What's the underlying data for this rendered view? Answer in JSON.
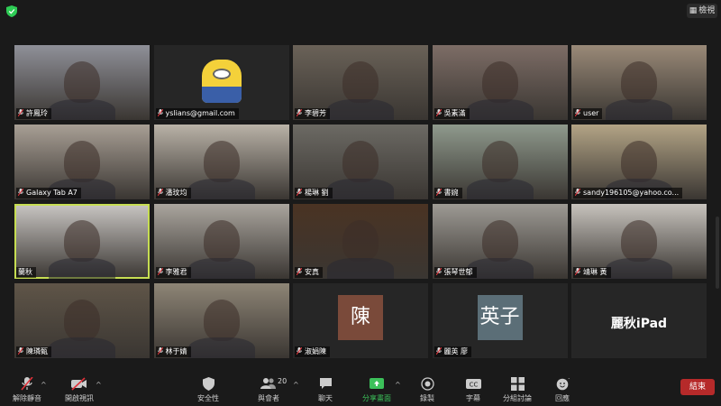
{
  "topbar": {
    "view_label": "檢視"
  },
  "participants": [
    {
      "name": "許鳳玲",
      "muted": true,
      "kind": "video",
      "bg": "#8f9098"
    },
    {
      "name": "yslians@gmail.com",
      "muted": true,
      "kind": "minion",
      "bg": "#232323"
    },
    {
      "name": "李碧芳",
      "muted": true,
      "kind": "video",
      "bg": "#6a6258"
    },
    {
      "name": "吳素滿",
      "muted": true,
      "kind": "video",
      "bg": "#7d6d66"
    },
    {
      "name": "user",
      "muted": true,
      "kind": "video",
      "bg": "#9a8a78"
    },
    {
      "name": "Galaxy Tab A7",
      "muted": true,
      "kind": "video",
      "bg": "#a89f95"
    },
    {
      "name": "潘玟均",
      "muted": true,
      "kind": "video",
      "bg": "#b9b2a7"
    },
    {
      "name": "楊琳 劉",
      "muted": true,
      "kind": "video",
      "bg": "#6c6a64"
    },
    {
      "name": "書婉",
      "muted": true,
      "kind": "video",
      "bg": "#8f9a8d"
    },
    {
      "name": "sandy196105@yahoo.co...",
      "muted": true,
      "kind": "video",
      "bg": "#b3a486"
    },
    {
      "name": "蘭秋",
      "muted": false,
      "kind": "video",
      "bg": "#c9c6c3",
      "active": true
    },
    {
      "name": "李雅君",
      "muted": true,
      "kind": "video",
      "bg": "#aaa59e"
    },
    {
      "name": "安真",
      "muted": true,
      "kind": "video",
      "bg": "#4a3323"
    },
    {
      "name": "張琴世郁",
      "muted": true,
      "kind": "video",
      "bg": "#9d9a94"
    },
    {
      "name": "靖琳 黃",
      "muted": true,
      "kind": "video",
      "bg": "#c7c3bd"
    },
    {
      "name": "陳璘甄",
      "muted": true,
      "kind": "video",
      "bg": "#5f5548"
    },
    {
      "name": "林于婧",
      "muted": true,
      "kind": "video",
      "bg": "#8e8576"
    },
    {
      "name": "淑娟陳",
      "muted": true,
      "kind": "avatar",
      "avatar_text": "陳",
      "avatar_color": "#7a4a3a"
    },
    {
      "name": "麗英 廖",
      "muted": true,
      "kind": "avatar",
      "avatar_text": "英子",
      "avatar_color": "#5b6e77"
    },
    {
      "name": "",
      "muted": false,
      "kind": "bigname",
      "big_text": "麗秋iPad"
    }
  ],
  "toolbar": {
    "unmute": "解除靜音",
    "start_video": "開啟視訊",
    "security": "安全性",
    "participants": "與會者",
    "participants_count": "20",
    "chat": "聊天",
    "share": "分享畫面",
    "record": "錄製",
    "captions": "字幕",
    "breakout": "分組討論",
    "reactions": "回應",
    "end": "結束"
  },
  "colors": {
    "active_border": "#c6dd52",
    "share_green": "#3cc15a",
    "end_red": "#b62a2a",
    "mute_red": "#e0323a"
  }
}
